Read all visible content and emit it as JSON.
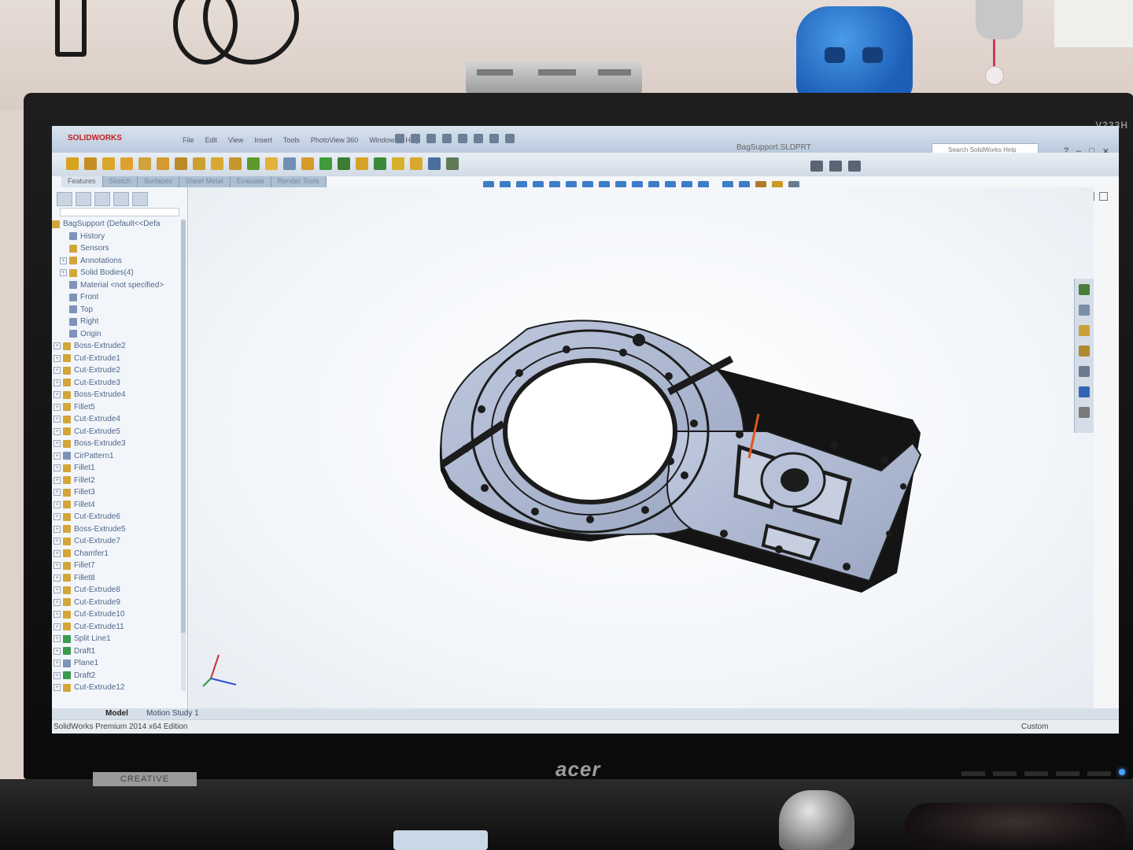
{
  "app": {
    "name": "SOLIDWORKS",
    "document_title": "BagSupport.SLDPRT",
    "search_placeholder": "Search SolidWorks Help",
    "menu": [
      "File",
      "Edit",
      "View",
      "Insert",
      "Tools",
      "PhotoView 360",
      "Window",
      "Help"
    ]
  },
  "command_tabs": [
    "Features",
    "Sketch",
    "Surfaces",
    "Sheet Metal",
    "Evaluate",
    "Render Tools"
  ],
  "feature_tree": {
    "root": "BagSupport  (Default<<Defa",
    "items": [
      {
        "label": "History",
        "icon": "history-icon"
      },
      {
        "label": "Sensors",
        "icon": "sensor-icon"
      },
      {
        "label": "Annotations",
        "icon": "annotation-icon"
      },
      {
        "label": "Solid Bodies(4)",
        "icon": "solid-bodies-icon"
      },
      {
        "label": "Material <not specified>",
        "icon": "material-icon"
      },
      {
        "label": "Front",
        "icon": "plane-icon"
      },
      {
        "label": "Top",
        "icon": "plane-icon"
      },
      {
        "label": "Right",
        "icon": "plane-icon"
      },
      {
        "label": "Origin",
        "icon": "origin-icon"
      },
      {
        "label": "Boss-Extrude2",
        "icon": "extrude-icon"
      },
      {
        "label": "Cut-Extrude1",
        "icon": "cut-extrude-icon"
      },
      {
        "label": "Cut-Extrude2",
        "icon": "cut-extrude-icon"
      },
      {
        "label": "Cut-Extrude3",
        "icon": "cut-extrude-icon"
      },
      {
        "label": "Boss-Extrude4",
        "icon": "extrude-icon"
      },
      {
        "label": "Fillet5",
        "icon": "fillet-icon"
      },
      {
        "label": "Cut-Extrude4",
        "icon": "cut-extrude-icon"
      },
      {
        "label": "Cut-Extrude5",
        "icon": "cut-extrude-icon"
      },
      {
        "label": "Boss-Extrude3",
        "icon": "extrude-icon"
      },
      {
        "label": "CirPattern1",
        "icon": "pattern-icon"
      },
      {
        "label": "Fillet1",
        "icon": "fillet-icon"
      },
      {
        "label": "Fillet2",
        "icon": "fillet-icon"
      },
      {
        "label": "Fillet3",
        "icon": "fillet-icon"
      },
      {
        "label": "Fillet4",
        "icon": "fillet-icon"
      },
      {
        "label": "Cut-Extrude6",
        "icon": "cut-extrude-icon"
      },
      {
        "label": "Boss-Extrude5",
        "icon": "extrude-icon"
      },
      {
        "label": "Cut-Extrude7",
        "icon": "cut-extrude-icon"
      },
      {
        "label": "Chamfer1",
        "icon": "chamfer-icon"
      },
      {
        "label": "Fillet7",
        "icon": "fillet-icon"
      },
      {
        "label": "Fillet8",
        "icon": "fillet-icon"
      },
      {
        "label": "Cut-Extrude8",
        "icon": "cut-extrude-icon"
      },
      {
        "label": "Cut-Extrude9",
        "icon": "cut-extrude-icon"
      },
      {
        "label": "Cut-Extrude10",
        "icon": "cut-extrude-icon"
      },
      {
        "label": "Cut-Extrude11",
        "icon": "cut-extrude-icon"
      },
      {
        "label": "Split Line1",
        "icon": "split-line-icon"
      },
      {
        "label": "Draft1",
        "icon": "draft-icon"
      },
      {
        "label": "Plane1",
        "icon": "plane-icon"
      },
      {
        "label": "Draft2",
        "icon": "draft-icon"
      },
      {
        "label": "Cut-Extrude12",
        "icon": "cut-extrude-icon"
      }
    ]
  },
  "bottom_tabs": [
    "Model",
    "Motion Study 1"
  ],
  "status": {
    "edition": "SolidWorks Premium 2014 x64 Edition",
    "units": "Custom"
  },
  "monitor": {
    "brand": "acer",
    "model": "V233H"
  },
  "desk_label": "CREATIVE",
  "colors": {
    "part_face": "#a9b4cf",
    "part_edge": "#1c1c1c",
    "titlebar": "#c5d3e3",
    "tree_text": "#50658a"
  }
}
